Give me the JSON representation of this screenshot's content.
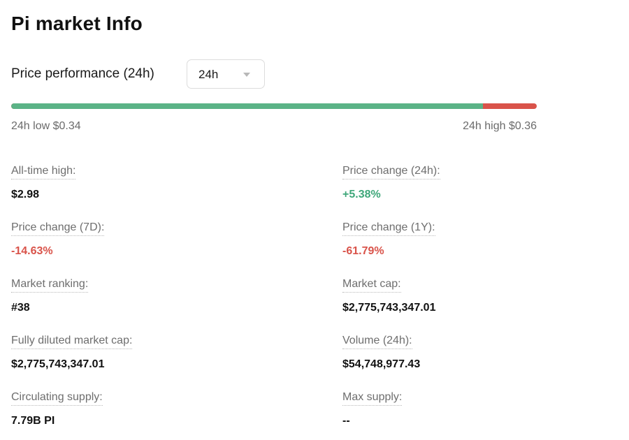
{
  "title": "Pi market Info",
  "performance": {
    "label": "Price performance (24h)",
    "period_selected": "24h",
    "low_text": "24h low $0.34",
    "high_text": "24h high $0.36",
    "current_position_fraction": 0.898
  },
  "stats": {
    "all_time_high": {
      "label": "All-time high:",
      "value": "$2.98"
    },
    "price_change_24h": {
      "label": "Price change (24h):",
      "value": "+5.38%",
      "trend": "up"
    },
    "price_change_7d": {
      "label": "Price change (7D):",
      "value": "-14.63%",
      "trend": "down"
    },
    "price_change_1y": {
      "label": "Price change (1Y):",
      "value": "-61.79%",
      "trend": "down"
    },
    "market_ranking": {
      "label": "Market ranking:",
      "value": "#38"
    },
    "market_cap": {
      "label": "Market cap:",
      "value": "$2,775,743,347.01"
    },
    "fdv": {
      "label": "Fully diluted market cap:",
      "value": "$2,775,743,347.01"
    },
    "volume_24h": {
      "label": "Volume (24h):",
      "value": "$54,748,977.43"
    },
    "circulating_supply": {
      "label": "Circulating supply:",
      "value": "7.79B PI"
    },
    "max_supply": {
      "label": "Max supply:",
      "value": "--"
    }
  },
  "colors": {
    "positive": "#3fa77a",
    "negative": "#d9534a",
    "bar_up": "#5bb386",
    "bar_down": "#d9534a"
  }
}
